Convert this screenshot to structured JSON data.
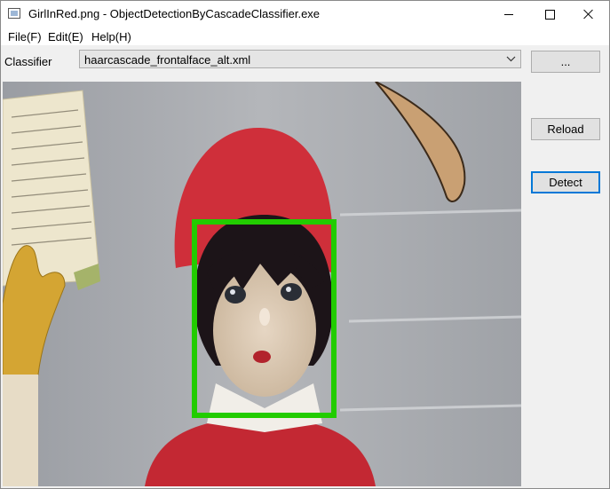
{
  "window": {
    "title": "GirlInRed.png - ObjectDetectionByCascadeClassifier.exe",
    "icon": "image-file-icon"
  },
  "menu": {
    "items": [
      {
        "label": "File(F)"
      },
      {
        "label": "Edit(E)"
      },
      {
        "label": "Help(H)"
      }
    ]
  },
  "classifier": {
    "label": "Classifier",
    "selected": "haarcascade_frontalface_alt.xml",
    "browse_label": "..."
  },
  "buttons": {
    "reload": "Reload",
    "detect": "Detect"
  },
  "image": {
    "description_icon": "photo-doll-girl-in-red",
    "detection_color": "#22cc00"
  },
  "colors": {
    "accent": "#0078d7",
    "box": "#22cc00"
  }
}
